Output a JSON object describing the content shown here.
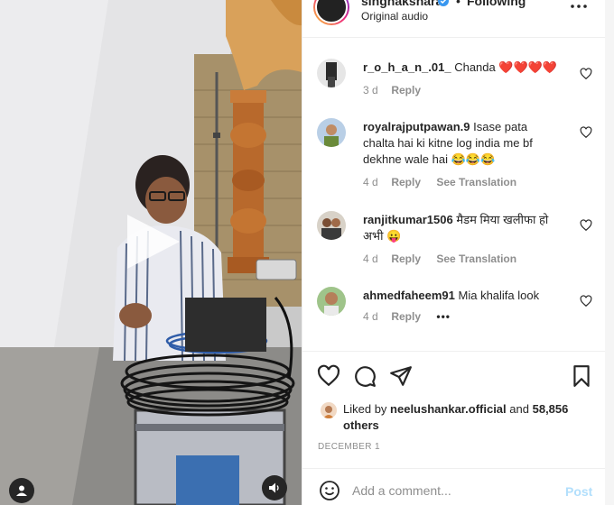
{
  "header": {
    "username": "singhakshara",
    "separator": "•",
    "follow_label": "Following",
    "audio_label": "Original audio",
    "more_icon": "more-horizontal-icon"
  },
  "comments": [
    {
      "username": "r_o_h_a_n_.01_",
      "text": "Chanda ❤️❤️❤️❤️",
      "time": "3 d",
      "reply_label": "Reply"
    },
    {
      "username": "royalrajputpawan.9",
      "text": "Isase pata chalta hai ki kitne log india me bf dekhne wale hai 😂😂😂",
      "time": "4 d",
      "reply_label": "Reply",
      "translate_label": "See Translation"
    },
    {
      "username": "ranjitkumar1506",
      "text": "मैडम मिया खलीफा हो अभी 😛",
      "time": "4 d",
      "reply_label": "Reply",
      "translate_label": "See Translation"
    },
    {
      "username": "ahmedfaheem91",
      "text": "Mia khalifa look",
      "time": "4 d",
      "reply_label": "Reply",
      "more_label": "•••"
    }
  ],
  "likes": {
    "prefix": "Liked by",
    "user": "neelushankar.official",
    "joiner": "and",
    "others": "58,856 others"
  },
  "date": "DECEMBER 1",
  "composer": {
    "placeholder": "Add a comment...",
    "post_label": "Post"
  },
  "colors": {
    "text": "#262626",
    "secondary": "#8e8e8e",
    "like_red": "#ed4956",
    "post_disabled": "#b2dffc",
    "divider": "#efefef"
  }
}
